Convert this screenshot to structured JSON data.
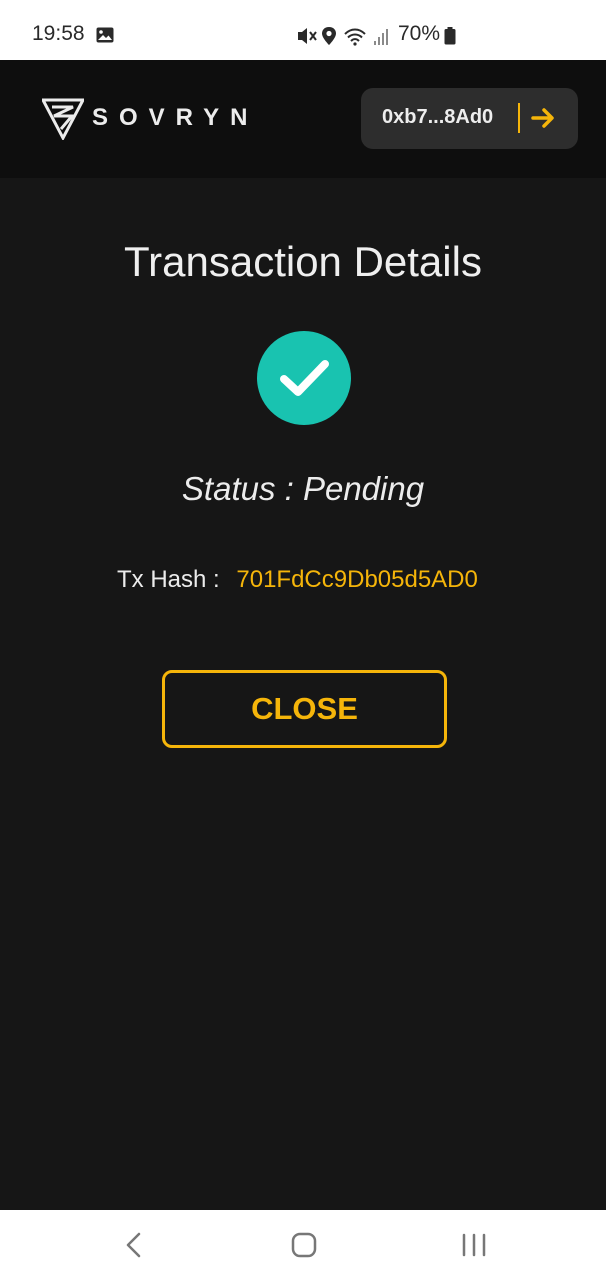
{
  "status_bar": {
    "time": "19:58",
    "battery": "70%",
    "icons": [
      "image-icon",
      "mute-icon",
      "location-icon",
      "wifi-icon",
      "signal-icon",
      "battery-icon"
    ]
  },
  "header": {
    "brand": "SOVRYN",
    "wallet_address": "0xb7...8Ad0",
    "accent": "#f5b50a"
  },
  "main": {
    "title": "Transaction Details",
    "status_text": "Status : Pending",
    "tx_hash_label": "Tx Hash :",
    "tx_hash_value": "701FdCc9Db05d5AD0",
    "close_label": "CLOSE",
    "check_color": "#19c3b0"
  },
  "nav": {
    "buttons": [
      "back-icon",
      "home-icon",
      "recent-apps-icon"
    ]
  }
}
